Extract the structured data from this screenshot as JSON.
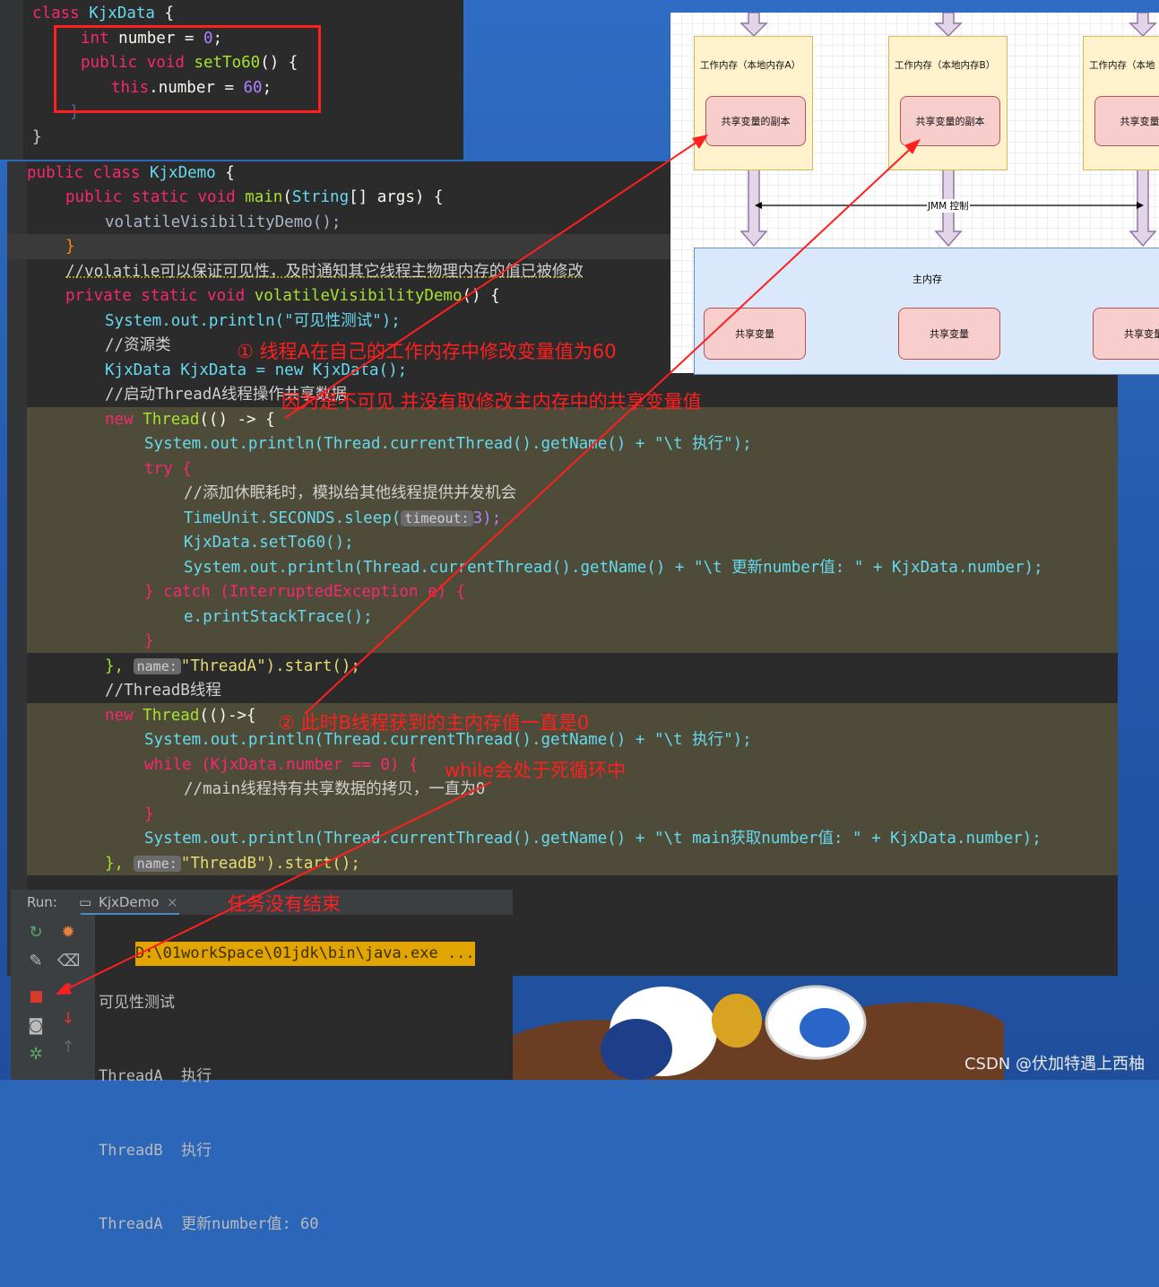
{
  "colors": {
    "annotation_red": "#ff1f1f",
    "editor_bg": "#2b2b2b",
    "diagram_wm": "#fff2cc",
    "diagram_copy": "#f8cecc",
    "diagram_main": "#dae8fc"
  },
  "top_code": {
    "l1": "class KjxData {",
    "l2": "int number = 0;",
    "l3": "public void setTo60() {",
    "l4": "this.number = 60;",
    "l5": "}",
    "l6": "}"
  },
  "main_code": {
    "c1": "public class KjxDemo {",
    "c2": "public static void main(String[] args) {",
    "c3": "volatileVisibilityDemo();",
    "c4": "}",
    "c5": "//volatile可以保证可见性，及时通知其它线程主物理内存的值已被修改",
    "c6": "private static void volatileVisibilityDemo() {",
    "c7": "System.out.println(\"可见性测试\");",
    "c8": "//资源类",
    "c9": "KjxData KjxData = new KjxData();",
    "c10": "//启动ThreadA线程操作共享数据",
    "c11": "new Thread(() -> {",
    "c12": "System.out.println(Thread.currentThread().getName() + \"\\t 执行\");",
    "c13": "try {",
    "c14": "//添加休眠耗时，模拟给其他线程提供并发机会",
    "c15a": "TimeUnit.SECONDS.sleep(",
    "c15hint": "timeout:",
    "c15b": "3);",
    "c16": "KjxData.setTo60();",
    "c17": "System.out.println(Thread.currentThread().getName() + \"\\t 更新number值: \" + KjxData.number);",
    "c18": "} catch (InterruptedException e) {",
    "c19": "e.printStackTrace();",
    "c20": "}",
    "c21a": "},",
    "c21hint": "name:",
    "c21b": "\"ThreadA\").start();",
    "c22": "//ThreadB线程",
    "c23": "new Thread(()->{",
    "c24": "System.out.println(Thread.currentThread().getName() + \"\\t 执行\");",
    "c25": "while (KjxData.number == 0) {",
    "c26": "//main线程持有共享数据的拷贝，一直为0",
    "c27": "}",
    "c28": "System.out.println(Thread.currentThread().getName() + \"\\t main获取number值: \" + KjxData.number);",
    "c29a": "},",
    "c29hint": "name:",
    "c29b": "\"ThreadB\").start();"
  },
  "annotations": {
    "a1": "① 线程A在自己的工作内存中修改变量值为60",
    "a2": "因为是不可见 并没有取修改主内存中的共享变量值",
    "a3": "② 此时B线程获到的主内存值一直是0",
    "a4": "while会处于死循环中",
    "a5": "任务没有结束"
  },
  "diagram": {
    "wm_a": "工作内存（本地内存A）",
    "wm_b": "工作内存（本地内存B）",
    "wm_c": "工作内存（本地",
    "copy_a": "共享变量的副本",
    "copy_b": "共享变量的副本",
    "copy_c": "共享变量的",
    "jmm": "JMM 控制",
    "main_mem": "主内存",
    "share_a": "共享变量",
    "share_b": "共享变量",
    "share_c": "共享变量"
  },
  "run": {
    "label": "Run:",
    "tab": "KjxDemo",
    "out1": "D:\\01workSpace\\01jdk\\bin\\java.exe ...",
    "out2": "可见性测试",
    "out3": "ThreadA  执行",
    "out4": "ThreadB  执行",
    "out5": "ThreadA  更新number值: 60"
  },
  "watermark": "CSDN @伏加特遇上西柚"
}
